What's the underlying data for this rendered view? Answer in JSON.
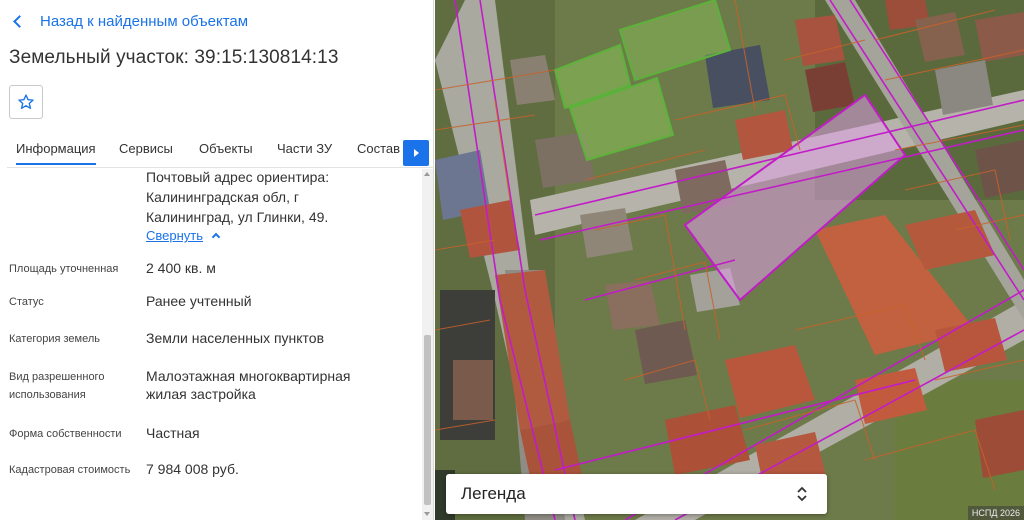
{
  "header": {
    "back_label": "Назад к найденным объектам",
    "title": "Земельный участок: 39:15:130814:13"
  },
  "tabs": [
    {
      "label": "Информация",
      "active": true
    },
    {
      "label": "Сервисы",
      "active": false
    },
    {
      "label": "Объекты",
      "active": false
    },
    {
      "label": "Части ЗУ",
      "active": false
    },
    {
      "label": "Состав",
      "active": false
    }
  ],
  "info": {
    "address": "Почтовый адрес ориентира: Калининградская обл, г Калининград, ул Глинки, 49.",
    "collapse_label": "Свернуть",
    "rows": [
      {
        "label": "Площадь уточненная",
        "value": "2 400 кв. м"
      },
      {
        "label": "Статус",
        "value": "Ранее учтенный"
      },
      {
        "label": "Категория земель",
        "value": "Земли населенных пунктов"
      },
      {
        "label": "Вид разрешенного использования",
        "value": "Малоэтажная многоквартирная жилая застройка"
      },
      {
        "label": "Форма собственности",
        "value": "Частная"
      },
      {
        "label": "Кадастровая стоимость",
        "value": "7 984 008 руб."
      }
    ]
  },
  "map": {
    "legend_label": "Легенда",
    "credit": "НСПД 2026"
  },
  "colors": {
    "accent": "#1a73e8",
    "selected_parcel": "#e0a0e8",
    "parcel_border": "#c21cc9",
    "highlight_parcel": "#8fd05c"
  },
  "icons": [
    "chevron-left-icon",
    "star-icon",
    "chevron-right-icon",
    "chevron-up-icon",
    "up-down-icon"
  ]
}
